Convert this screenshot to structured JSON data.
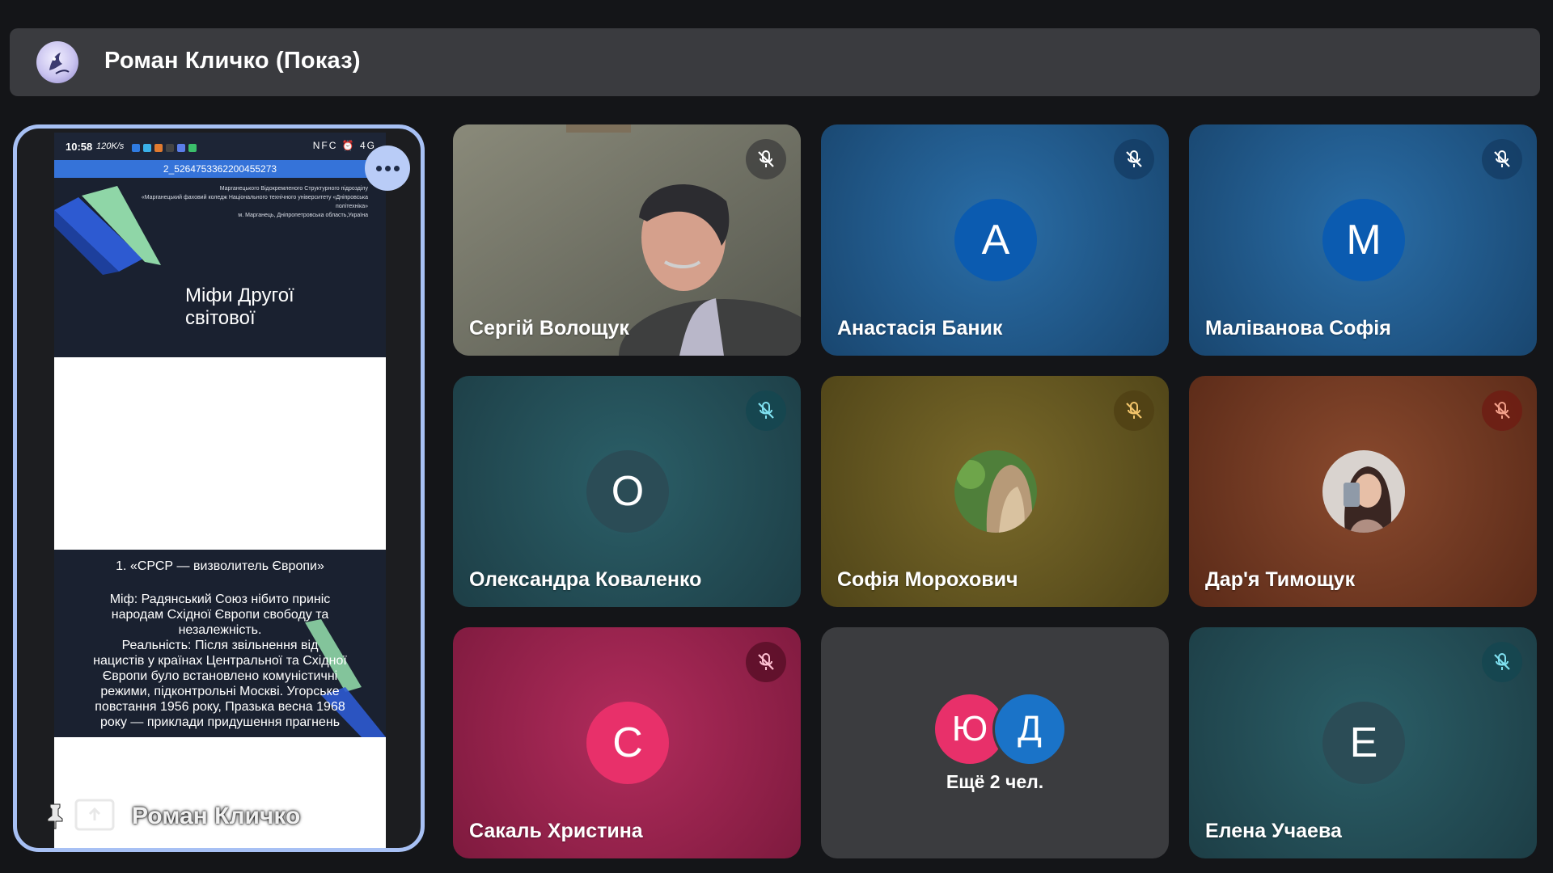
{
  "presenter_bar": {
    "title": "Роман Кличко (Показ)"
  },
  "presentation": {
    "status_time": "10:58",
    "status_speed": "120K/s",
    "status_right": "NFC ⏰ 4G",
    "file_name": "2_5264753362200455273",
    "slide1_header_lines": [
      "Марганецького Відокремленого Структурного підрозділу",
      "«Марганецький фаховий коледж Національного технічного університету «Дніпровська політехніка»",
      "м. Марганець, Дніпропетровська область,Україна"
    ],
    "slide1_title_line1": "Міфи Другої",
    "slide1_title_line2": "світової",
    "slide2_heading": "1.  «СРСР — визволитель Європи»",
    "slide2_body_lines": [
      "Міф: Радянський Союз нібито приніс",
      "народам Східної Європи свободу та",
      "незалежність.",
      "Реальність: Після звільнення від",
      "нацистів у країнах Центральної та Східної",
      "Європи було встановлено комуністичні",
      "режими, підконтрольні Москві. Угорське",
      "повстання 1956 року, Празька весна 1968",
      "року — приклади придушення прагнень"
    ],
    "presenter_name": "Роман Кличко"
  },
  "participants": [
    {
      "name": "Сергій Волощук",
      "type": "video"
    },
    {
      "name": "Анастасія Баник",
      "initial": "А",
      "type": "letter",
      "bg": "#1e4f86",
      "avatar_color": "#0b5bb0"
    },
    {
      "name": "Маліванова Софія",
      "initial": "M",
      "type": "letter",
      "bg": "#1e4f86",
      "avatar_color": "#0b5bb0"
    },
    {
      "name": "Олександра Коваленко",
      "initial": "O",
      "type": "letter",
      "bg": "#1f4b56",
      "avatar_color": "#2b4c56"
    },
    {
      "name": "Софія Морохович",
      "type": "photo",
      "bg": "#6a5a22"
    },
    {
      "name": "Дар'я Тимощук",
      "type": "photo",
      "bg": "#7a3a23"
    },
    {
      "name": "Сакаль Христина",
      "initial": "C",
      "type": "letter",
      "bg": "#a8234f",
      "avatar_color": "#e8306a"
    },
    {
      "name": "Ещё 2 чел.",
      "type": "group",
      "initials": [
        "Ю",
        "Д"
      ]
    },
    {
      "name": "Елена Учаева",
      "initial": "E",
      "type": "letter",
      "bg": "#1f4b56",
      "avatar_color": "#2b4c56"
    }
  ],
  "colors": {
    "background": "#141518",
    "presenter_bar": "#3a3b3f",
    "present_border": "#a7c0f4",
    "group_avatar_1": "#e8306a",
    "group_avatar_2": "#1a73c8"
  }
}
